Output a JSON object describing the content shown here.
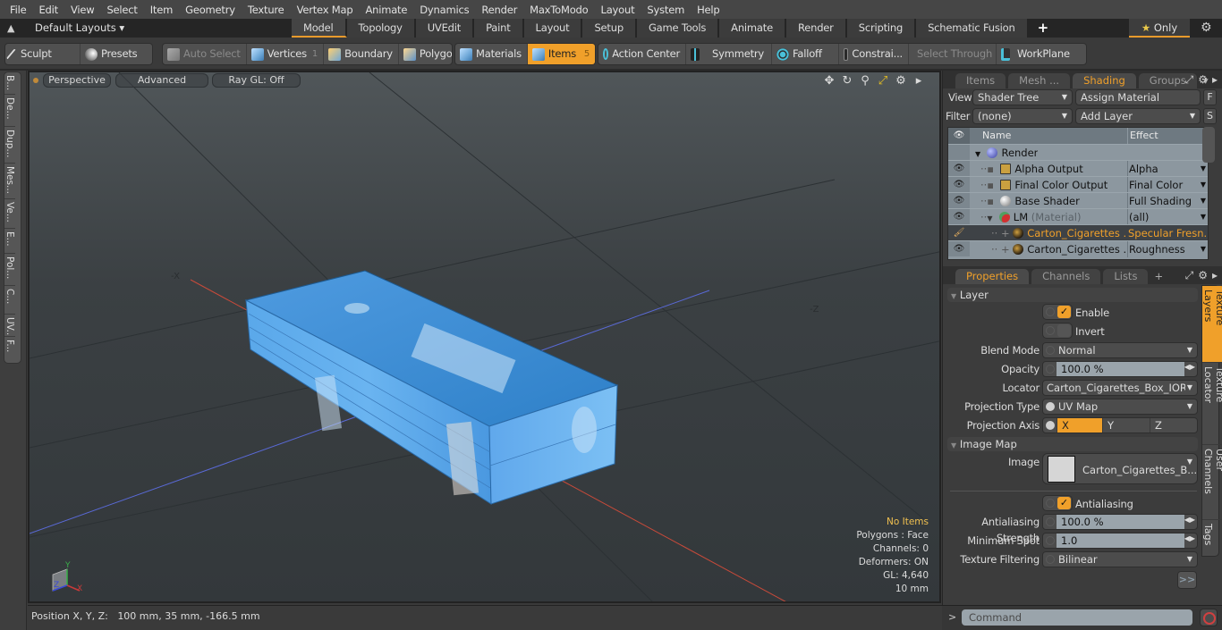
{
  "menu": [
    "File",
    "Edit",
    "View",
    "Select",
    "Item",
    "Geometry",
    "Texture",
    "Vertex Map",
    "Animate",
    "Dynamics",
    "Render",
    "MaxToModo",
    "Layout",
    "System",
    "Help"
  ],
  "layoutbar": {
    "layouts_label": "Default Layouts ▾",
    "tabs": [
      "Model",
      "Topology",
      "UVEdit",
      "Paint",
      "Layout",
      "Setup",
      "Game Tools",
      "Animate",
      "Render",
      "Scripting",
      "Schematic Fusion"
    ],
    "active_tab": "Model",
    "add_tab": "+",
    "only_label": "Only",
    "star": "★"
  },
  "toolbar": {
    "sculpt": "Sculpt",
    "presets": "Presets",
    "auto_select": "Auto Select",
    "vertices": "Vertices",
    "vertices_count": "1",
    "boundary": "Boundary",
    "polygons": "Polygons",
    "materials": "Materials",
    "items": "Items",
    "items_count": "5",
    "action_center": "Action Center",
    "symmetry": "Symmetry",
    "falloff": "Falloff",
    "constraints": "Constrai...",
    "select_through": "Select Through",
    "workplane": "WorkPlane"
  },
  "left_tabs": [
    "B...",
    "De...",
    "Dup...",
    "Mes...",
    "Ve...",
    "E...",
    "Pol...",
    "C...",
    "UV...",
    "F..."
  ],
  "viewport": {
    "view_mode": "Perspective",
    "shading": "Advanced",
    "raygl": "Ray GL: Off",
    "axis_labels": {
      "neg_x": "-X",
      "neg_z": "-Z"
    },
    "info": {
      "items": "No Items",
      "polygons": "Polygons : Face",
      "channels": "Channels: 0",
      "deformers": "Deformers: ON",
      "gl": "GL: 4,640",
      "scale": "10 mm"
    },
    "gizmo": {
      "x": "X",
      "y": "Y",
      "z": "Z"
    },
    "colors": {
      "x_axis": "#d04a3a",
      "z_axis": "#5a6ad8",
      "box": "#4a9ae0"
    }
  },
  "status": {
    "position_label": "Position X, Y, Z:",
    "position_value": "100 mm, 35 mm, -166.5 mm"
  },
  "shading_panel": {
    "tabs": [
      "Items",
      "Mesh ...",
      "Shading",
      "Groups"
    ],
    "active_tab": "Shading",
    "view_label": "View",
    "view_value": "Shader Tree",
    "assign_material": "Assign Material",
    "f_button": "F",
    "filter_label": "Filter",
    "filter_value": "(none)",
    "add_layer": "Add Layer",
    "s_button": "S",
    "columns": {
      "name": "Name",
      "effect": "Effect"
    },
    "rows": [
      {
        "name": "Render",
        "sub": "",
        "effect": "",
        "icon": "render-sphere",
        "selected": false,
        "visible": false
      },
      {
        "name": "Alpha Output",
        "sub": "",
        "effect": "Alpha",
        "icon": "output",
        "selected": false,
        "visible": true
      },
      {
        "name": "Final Color Output",
        "sub": "",
        "effect": "Final Color",
        "icon": "output",
        "selected": false,
        "visible": true
      },
      {
        "name": "Base Shader",
        "sub": "",
        "effect": "Full Shading",
        "icon": "shader-sphere",
        "selected": false,
        "visible": true
      },
      {
        "name": "LM",
        "sub": "(Material)",
        "effect": "(all)",
        "icon": "material",
        "selected": false,
        "visible": true
      },
      {
        "name": "Carton_Cigarettes ...",
        "sub": "",
        "effect": "Specular Fresn...",
        "icon": "image-layer",
        "selected": true,
        "visible": true
      },
      {
        "name": "Carton_Cigarettes ...",
        "sub": "",
        "effect": "Roughness",
        "icon": "image-layer",
        "selected": false,
        "visible": true
      }
    ]
  },
  "properties_panel": {
    "tabs": [
      "Properties",
      "Channels",
      "Lists"
    ],
    "active_tab": "Properties",
    "add_tab": "+",
    "layer_section": "Layer",
    "enable_label": "Enable",
    "enable": true,
    "invert_label": "Invert",
    "invert": false,
    "blend_mode_label": "Blend Mode",
    "blend_mode": "Normal",
    "opacity_label": "Opacity",
    "opacity": "100.0 %",
    "locator_label": "Locator",
    "locator": "Carton_Cigarettes_Box_IOR ...",
    "projection_type_label": "Projection Type",
    "projection_type": "UV Map",
    "projection_axis_label": "Projection Axis",
    "projection_axes": [
      "X",
      "Y",
      "Z"
    ],
    "projection_axis": "X",
    "image_map_section": "Image Map",
    "image_label": "Image",
    "image": "Carton_Cigarettes_B...",
    "antialiasing_label": "Antialiasing",
    "antialiasing": true,
    "aa_strength_label": "Antialiasing Strength",
    "aa_strength": "100.0 %",
    "min_spot_label": "Minimum Spot",
    "min_spot": "1.0",
    "tex_filter_label": "Texture Filtering",
    "tex_filter": "Bilinear",
    "more_button": ">>",
    "side_tabs": [
      "Texture Layers",
      "Texture Locator",
      "User Channels",
      "Tags"
    ],
    "active_side_tab": "Texture Layers"
  },
  "command": {
    "prompt": ">",
    "placeholder": "Command"
  },
  "accent_color": "#f0a02a"
}
